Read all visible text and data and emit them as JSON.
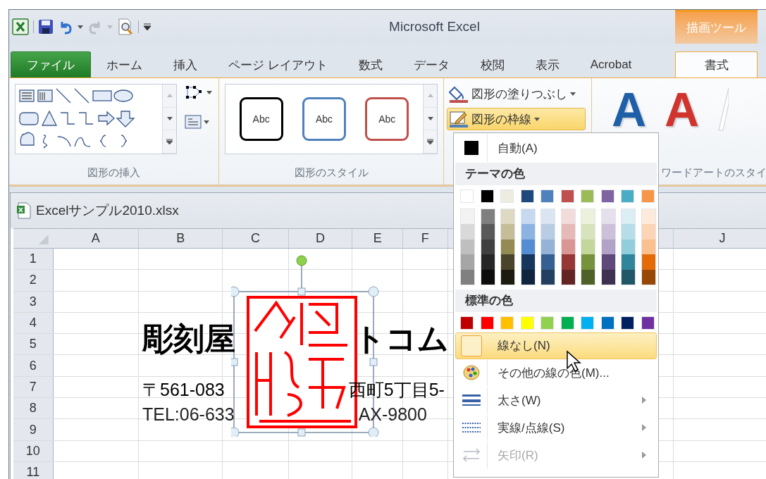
{
  "window": {
    "title": "Microsoft Excel"
  },
  "contextual_tab_group": {
    "label": "描画ツール"
  },
  "tabs": [
    {
      "label": "ファイル",
      "kind": "file",
      "selected": false
    },
    {
      "label": "ホーム",
      "kind": "tab",
      "selected": false
    },
    {
      "label": "挿入",
      "kind": "tab",
      "selected": false
    },
    {
      "label": "ページ レイアウト",
      "kind": "tab",
      "selected": false
    },
    {
      "label": "数式",
      "kind": "tab",
      "selected": false
    },
    {
      "label": "データ",
      "kind": "tab",
      "selected": false
    },
    {
      "label": "校閲",
      "kind": "tab",
      "selected": false
    },
    {
      "label": "表示",
      "kind": "tab",
      "selected": false
    },
    {
      "label": "Acrobat",
      "kind": "tab",
      "selected": false
    },
    {
      "label": "書式",
      "kind": "contextual",
      "selected": true
    }
  ],
  "ribbon": {
    "insert_shapes": {
      "label": "図形の挿入"
    },
    "shape_styles": {
      "label": "図形のスタイル",
      "samples": [
        {
          "text": "Abc",
          "color": "#000000"
        },
        {
          "text": "Abc",
          "color": "#4f81bd"
        },
        {
          "text": "Abc",
          "color": "#c0504d"
        }
      ]
    },
    "shape_fill": {
      "label": "図形の塗りつぶし",
      "pressed": false
    },
    "shape_outline": {
      "label": "図形の枠線",
      "pressed": true
    },
    "wordart_styles": {
      "label": "ワードアートのスタイ",
      "samples": [
        {
          "text": "A",
          "color": "#1f5fa8"
        },
        {
          "text": "A",
          "color": "#d0342c"
        }
      ]
    }
  },
  "workbook": {
    "title": "Excelサンプル2010.xlsx"
  },
  "sheet": {
    "columns": [
      "A",
      "B",
      "C",
      "D",
      "E",
      "F",
      "J"
    ],
    "rows": [
      "1",
      "2",
      "3",
      "4",
      "5",
      "6",
      "7",
      "8",
      "9",
      "10",
      "11"
    ],
    "title_fragments": [
      "彫刻屋",
      "トコム"
    ],
    "address_fragments": [
      "〒561-083",
      "西町5丁目5-"
    ],
    "phone_fragments": [
      "TEL:06-633",
      "AX-9800"
    ]
  },
  "outline_menu": {
    "automatic": {
      "label": "自動(A)",
      "color": "#000000"
    },
    "theme_header": "テーマの色",
    "theme_colors": [
      {
        "color": "#ffffff",
        "shades": [
          {
            "color": "#f2f2f2"
          },
          {
            "color": "#d9d9d9"
          },
          {
            "color": "#bfbfbf"
          },
          {
            "color": "#a6a6a6"
          },
          {
            "color": "#808080"
          }
        ]
      },
      {
        "color": "#000000",
        "shades": [
          {
            "color": "#7f7f7f"
          },
          {
            "color": "#595959"
          },
          {
            "color": "#404040"
          },
          {
            "color": "#262626"
          },
          {
            "color": "#0d0d0d"
          }
        ]
      },
      {
        "color": "#eeece1",
        "shades": [
          {
            "color": "#ddd9c3"
          },
          {
            "color": "#c4bd97"
          },
          {
            "color": "#948a54"
          },
          {
            "color": "#4a452a"
          },
          {
            "color": "#1d1b10"
          }
        ]
      },
      {
        "color": "#1f497d",
        "shades": [
          {
            "color": "#c6d9f0"
          },
          {
            "color": "#8db3e2"
          },
          {
            "color": "#548dd4"
          },
          {
            "color": "#17365d"
          },
          {
            "color": "#0f243e"
          }
        ]
      },
      {
        "color": "#4f81bd",
        "shades": [
          {
            "color": "#dbe5f1"
          },
          {
            "color": "#b8cce4"
          },
          {
            "color": "#95b3d7"
          },
          {
            "color": "#366092"
          },
          {
            "color": "#244061"
          }
        ]
      },
      {
        "color": "#c0504d",
        "shades": [
          {
            "color": "#f2dcdb"
          },
          {
            "color": "#e5b9b7"
          },
          {
            "color": "#d99694"
          },
          {
            "color": "#953734"
          },
          {
            "color": "#632423"
          }
        ]
      },
      {
        "color": "#9bbb59",
        "shades": [
          {
            "color": "#ebf1dd"
          },
          {
            "color": "#d7e3bc"
          },
          {
            "color": "#c3d69b"
          },
          {
            "color": "#76923c"
          },
          {
            "color": "#4f6128"
          }
        ]
      },
      {
        "color": "#8064a2",
        "shades": [
          {
            "color": "#e5e0ec"
          },
          {
            "color": "#ccc1d9"
          },
          {
            "color": "#b2a2c7"
          },
          {
            "color": "#5f497a"
          },
          {
            "color": "#3f3151"
          }
        ]
      },
      {
        "color": "#4bacc6",
        "shades": [
          {
            "color": "#dbeef3"
          },
          {
            "color": "#b7dde8"
          },
          {
            "color": "#92cddc"
          },
          {
            "color": "#31859b"
          },
          {
            "color": "#205867"
          }
        ]
      },
      {
        "color": "#f79646",
        "shades": [
          {
            "color": "#fdeada"
          },
          {
            "color": "#fbd5b5"
          },
          {
            "color": "#fac08f"
          },
          {
            "color": "#e36c09"
          },
          {
            "color": "#974806"
          }
        ]
      }
    ],
    "standard_header": "標準の色",
    "standard_colors": [
      {
        "color": "#c00000"
      },
      {
        "color": "#ff0000"
      },
      {
        "color": "#ffc000"
      },
      {
        "color": "#ffff00"
      },
      {
        "color": "#92d050"
      },
      {
        "color": "#00b050"
      },
      {
        "color": "#00b0f0"
      },
      {
        "color": "#0070c0"
      },
      {
        "color": "#002060"
      },
      {
        "color": "#7030a0"
      }
    ],
    "items": [
      {
        "kind": "no_line",
        "label": "線なし(N)",
        "selected": true,
        "disabled": false,
        "submenu": false
      },
      {
        "kind": "more_colors",
        "label": "その他の線の色(M)...",
        "selected": false,
        "disabled": false,
        "submenu": false
      },
      {
        "kind": "weight",
        "label": "太さ(W)",
        "selected": false,
        "disabled": false,
        "submenu": true
      },
      {
        "kind": "dash",
        "label": "実線/点線(S)",
        "selected": false,
        "disabled": false,
        "submenu": true
      },
      {
        "kind": "arrows",
        "label": "矢印(R)",
        "selected": false,
        "disabled": true,
        "submenu": true
      }
    ]
  }
}
